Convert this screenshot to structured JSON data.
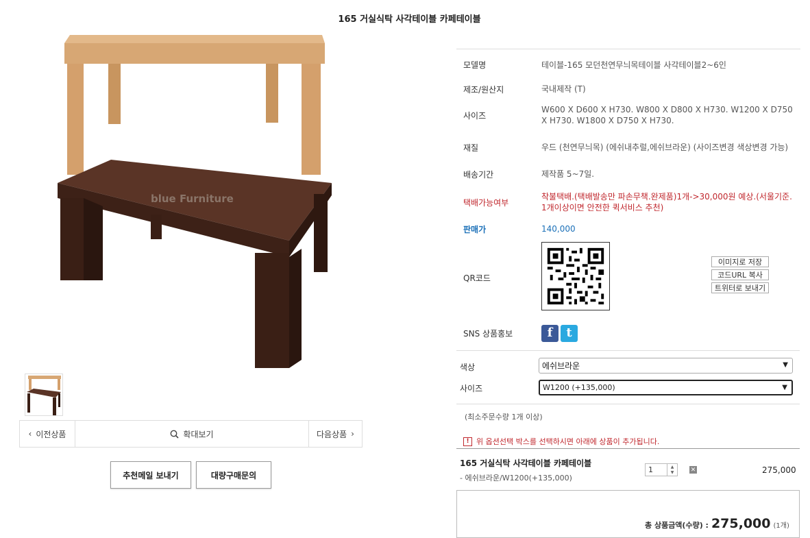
{
  "page_title": "165 거실식탁 사각테이블 카페테이블",
  "image_watermark": "blue Furniture",
  "nav": {
    "prev": "이전상품",
    "zoom": "확대보기",
    "next": "다음상품"
  },
  "buttons": {
    "recommend_mail": "추천메일 보내기",
    "bulk_inquiry": "대량구매문의"
  },
  "info": {
    "model_label": "모델명",
    "model_value": "테이블-165 모던천연무늬목테이블 사각테이블2~6인",
    "origin_label": "제조/원산지",
    "origin_value": "국내제작 (T)",
    "size_label": "사이즈",
    "size_value": "W600 X D600 X H730. W800 X D800 X H730. W1200 X D750 X H730. W1800 X D750 X H730.",
    "material_label": "재질",
    "material_value": "우드 (천연무늬목) (에쉬내추럴,에쉬브라운) (사이즈변경 색상변경 가능)",
    "delivery_label": "배송기간",
    "delivery_value": "제작품 5~7일.",
    "courier_label": "택배가능여부",
    "courier_value": "착불택배.(택배발송만 파손무책.완제품)1개->30,000원 예상.(서울기준. 1개이상이면 안전한 퀵서비스 추천)",
    "price_label": "판매가",
    "price_value": "140,000",
    "qr_label": "QR코드",
    "qr_buttons": [
      "이미지로 저장",
      "코드URL 복사",
      "트위터로 보내기"
    ],
    "sns_label": "SNS 상품홍보"
  },
  "options": {
    "color_label": "색상",
    "color_value": "에쉬브라운",
    "size_label": "사이즈",
    "size_value": "W1200 (+135,000)"
  },
  "min_order": "(최소주문수량 1개 이상)",
  "notice": "위 옵션선택 박스를 선택하시면 아래에 상품이 추가됩니다.",
  "selected_item": {
    "name": "165 거실식탁 사각테이블 카페테이블",
    "option": "- 에쉬브라운/W1200(+135,000)",
    "qty": "1",
    "price": "275,000"
  },
  "total": {
    "label": "총 상품금액(수량) :",
    "amount": "275,000",
    "count": "(1개)"
  },
  "colors": {
    "red": "#c0272d",
    "blue": "#1b70b8",
    "facebook": "#3b5998",
    "twitter": "#2aa9e0"
  }
}
